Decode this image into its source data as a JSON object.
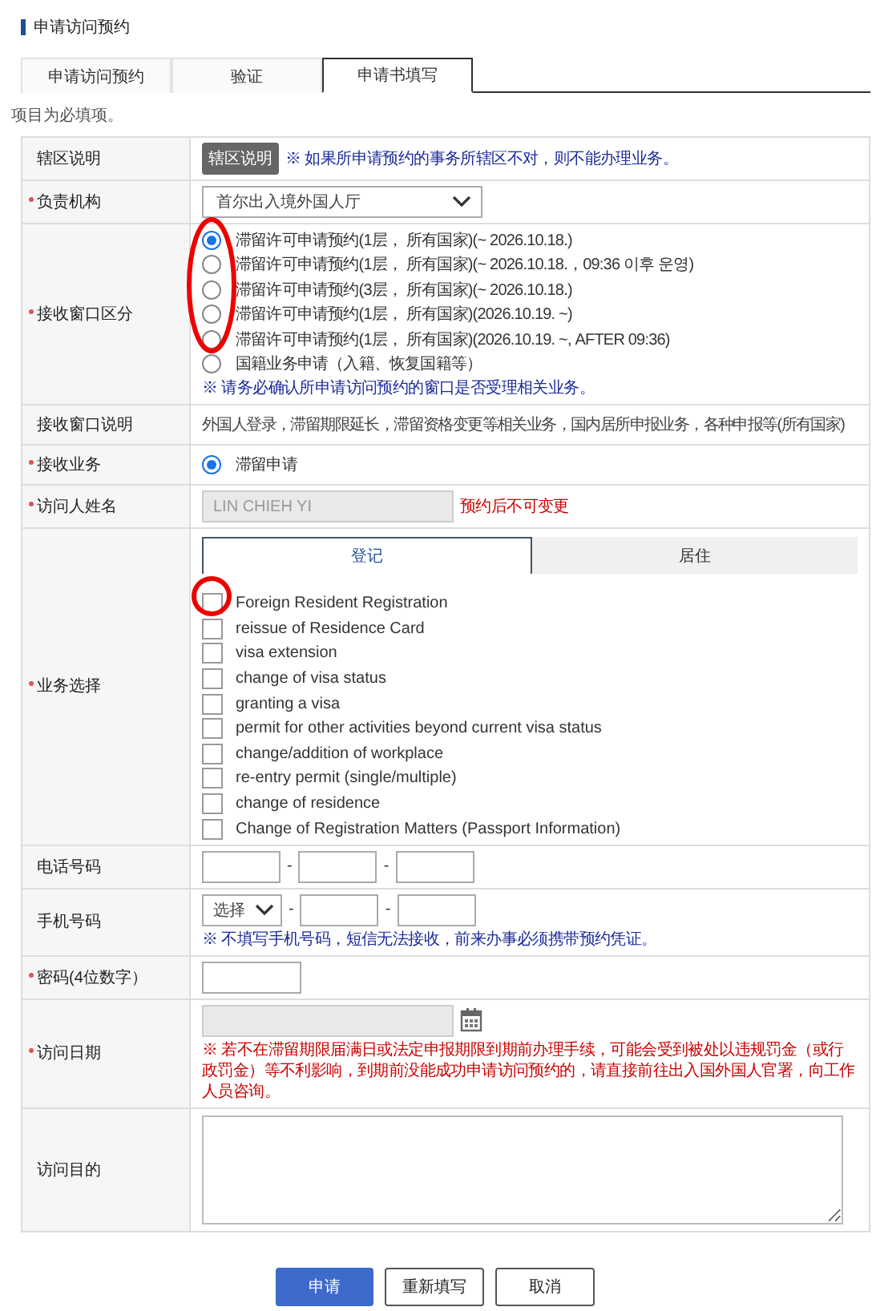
{
  "page_title": "申请访问预约",
  "tabs": [
    {
      "label": "申请访问预约",
      "selected": false
    },
    {
      "label": "验证",
      "selected": false
    },
    {
      "label": "申请书填写",
      "selected": true
    }
  ],
  "required_note": "项目为必填项。",
  "rows": [
    {
      "kind": "zone",
      "label": "辖区说明",
      "required": false,
      "button": "辖区说明",
      "note": "※ 如果所申请预约的事务所辖区不对，则不能办理业务。"
    },
    {
      "kind": "select",
      "label": "负责机构",
      "required": true,
      "value": "首尔出入境外国人厅"
    },
    {
      "kind": "radios",
      "label": "接收窗口区分",
      "required": true,
      "options": [
        {
          "label": "滞留许可申请预约(1层， 所有国家)(~ 2026.10.18.)",
          "selected": true
        },
        {
          "label": "滞留许可申请预约(1层， 所有国家)(~ 2026.10.18.，09:36 이후 운영)",
          "selected": false
        },
        {
          "label": "滞留许可申请预约(3层， 所有国家)(~ 2026.10.18.)",
          "selected": false
        },
        {
          "label": "滞留许可申请预约(1层， 所有国家)(2026.10.19. ~)",
          "selected": false
        },
        {
          "label": "滞留许可申请预约(1层， 所有国家)(2026.10.19. ~, AFTER 09:36)",
          "selected": false
        },
        {
          "label": "国籍业务申请（入籍、恢复国籍等）",
          "selected": false
        }
      ],
      "note": "※ 请务必确认所申请访问预约的窗口是否受理相关业务。"
    },
    {
      "kind": "text",
      "label": "接收窗口说明",
      "required": false,
      "text": "外国人登录，滞留期限延长，滞留资格变更等相关业务，国内居所申报业务，各种申报等(所有国家)"
    },
    {
      "kind": "radios",
      "label": "接收业务",
      "required": true,
      "options": [
        {
          "label": "滞留申请",
          "selected": true
        }
      ]
    },
    {
      "kind": "readonly",
      "label": "访问人姓名",
      "required": true,
      "value": "LIN CHIEH YI",
      "warning": "预约后不可变更"
    },
    {
      "kind": "tasks",
      "label": "业务选择",
      "required": true,
      "tabs": [
        {
          "label": "登记",
          "selected": true
        },
        {
          "label": "居住",
          "selected": false
        }
      ],
      "items": [
        {
          "label": "Foreign Resident Registration",
          "checked": false
        },
        {
          "label": "reissue of Residence Card",
          "checked": false
        },
        {
          "label": "visa extension",
          "checked": false
        },
        {
          "label": "change of visa status",
          "checked": false
        },
        {
          "label": "granting a visa",
          "checked": false
        },
        {
          "label": "permit for other activities beyond current visa status",
          "checked": false
        },
        {
          "label": "change/addition of workplace",
          "checked": false
        },
        {
          "label": "re-entry permit (single/multiple)",
          "checked": false
        },
        {
          "label": "change of residence",
          "checked": false
        },
        {
          "label": "Change of Registration Matters (Passport Information)",
          "checked": false
        }
      ]
    },
    {
      "kind": "phone",
      "label": "电话号码",
      "required": false,
      "separator": "-"
    },
    {
      "kind": "mobile",
      "label": "手机号码",
      "required": false,
      "separator": "-",
      "select": "选择",
      "note": "※ 不填写手机号码，短信无法接收，前来办事必须携带预约凭证。"
    },
    {
      "kind": "password",
      "label": "密码(4位数字）",
      "required": true
    },
    {
      "kind": "date",
      "label": "访问日期",
      "required": true,
      "warning": "※ 若不在滞留期限届满日或法定申报期限到期前办理手续，可能会受到被处以违规罚金（或行政罚金）等不利影响，到期前没能成功申请访问预约的，请直接前往出入国外国人官署，向工作人员咨询。"
    },
    {
      "kind": "textarea",
      "label": "访问目的",
      "required": false
    }
  ],
  "buttons": [
    {
      "label": "申请",
      "primary": true
    },
    {
      "label": "重新填写",
      "primary": false
    },
    {
      "label": "取消",
      "primary": false
    }
  ]
}
